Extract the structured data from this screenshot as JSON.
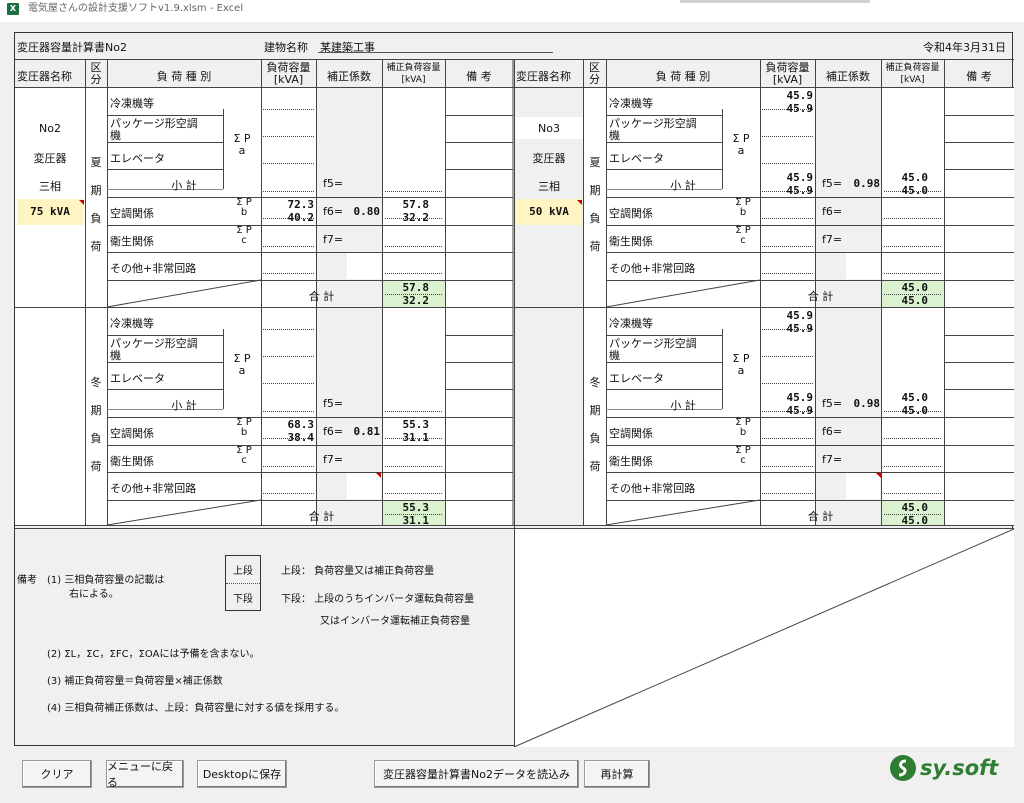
{
  "window": {
    "title": "電気屋さんの設計支援ソフトv1.9.xlsm - Excel"
  },
  "header": {
    "doc_title": "変圧器容量計算書No2",
    "bldg_label": "建物名称",
    "bldg_name": "某建築工事",
    "date": "令和4年3月31日"
  },
  "cols": {
    "name": "変圧器名称",
    "kubun1": "区",
    "kubun2": "分",
    "load": "負 荷 種 別",
    "cap1": "負荷容量",
    "cap2": "[kVA]",
    "coef": "補正係数",
    "corr1": "補正負荷容量",
    "corr2": "[kVA]",
    "note": "備 考"
  },
  "rows": {
    "refrig": "冷凍機等",
    "pkg1": "パッケージ形空調",
    "pkg2": "機",
    "elev": "エレベータ",
    "subtotal": "小 計",
    "hvac": "空調関係",
    "sanit": "衛生関係",
    "other": "その他+非常回路",
    "total": "合 計",
    "sigma_p": "Σ P",
    "a": "a",
    "b": "b",
    "c": "c",
    "f5": "f5=",
    "f6": "f6=",
    "f7": "f7="
  },
  "season": {
    "summer": [
      "夏",
      "期",
      "負",
      "荷"
    ],
    "winter": [
      "冬",
      "期",
      "負",
      "荷"
    ]
  },
  "tx_left": {
    "no": "No2",
    "name": "変圧器",
    "phase": "三相",
    "kva": "75 kVA",
    "s_hvac_cap": [
      "72.3",
      "40.2"
    ],
    "s_f6": "0.80",
    "s_hvac_corr": [
      "57.8",
      "32.2"
    ],
    "s_total": [
      "57.8",
      "32.2"
    ],
    "w_hvac_cap": [
      "68.3",
      "38.4"
    ],
    "w_f6": "0.81",
    "w_hvac_corr": [
      "55.3",
      "31.1"
    ],
    "w_total": [
      "55.3",
      "31.1"
    ]
  },
  "tx_right": {
    "no": "No3",
    "name": "変圧器",
    "phase": "三相",
    "kva": "50 kVA",
    "s_ref_cap": [
      "45.9",
      "45.9"
    ],
    "s_sub_cap": [
      "45.9",
      "45.9"
    ],
    "s_f5": "0.98",
    "s_sub_corr": [
      "45.0",
      "45.0"
    ],
    "s_total": [
      "45.0",
      "45.0"
    ],
    "w_ref_cap": [
      "45.9",
      "45.9"
    ],
    "w_sub_cap": [
      "45.9",
      "45.9"
    ],
    "w_f5": "0.98",
    "w_sub_corr": [
      "45.0",
      "45.0"
    ],
    "w_total": [
      "45.0",
      "45.0"
    ]
  },
  "notes": {
    "label": "備考",
    "n1a": "(1) 三相負荷容量の記載は",
    "n1b": "右による。",
    "upper": "上段",
    "lower": "下段",
    "upper_desc": "上段： 負荷容量又は補正負荷容量",
    "lower_desc1": "下段： 上段のうちインバータ運転負荷容量",
    "lower_desc2": "又はインバータ運転補正負荷容量",
    "n2": "(2) ΣL，ΣC，ΣFC，ΣOAには予備を含まない。",
    "n3": "(3) 補正負荷容量＝負荷容量×補正係数",
    "n4": "(4) 三相負荷補正係数は、上段：負荷容量に対する値を採用する。"
  },
  "buttons": {
    "clear": "クリア",
    "menu": "メニューに戻る",
    "desktop": "Desktopに保存",
    "load": "変圧器容量計算書No2データを読込み",
    "recalc": "再計算"
  },
  "logo": {
    "text": "sy.soft",
    "color": "#2f7d32"
  }
}
